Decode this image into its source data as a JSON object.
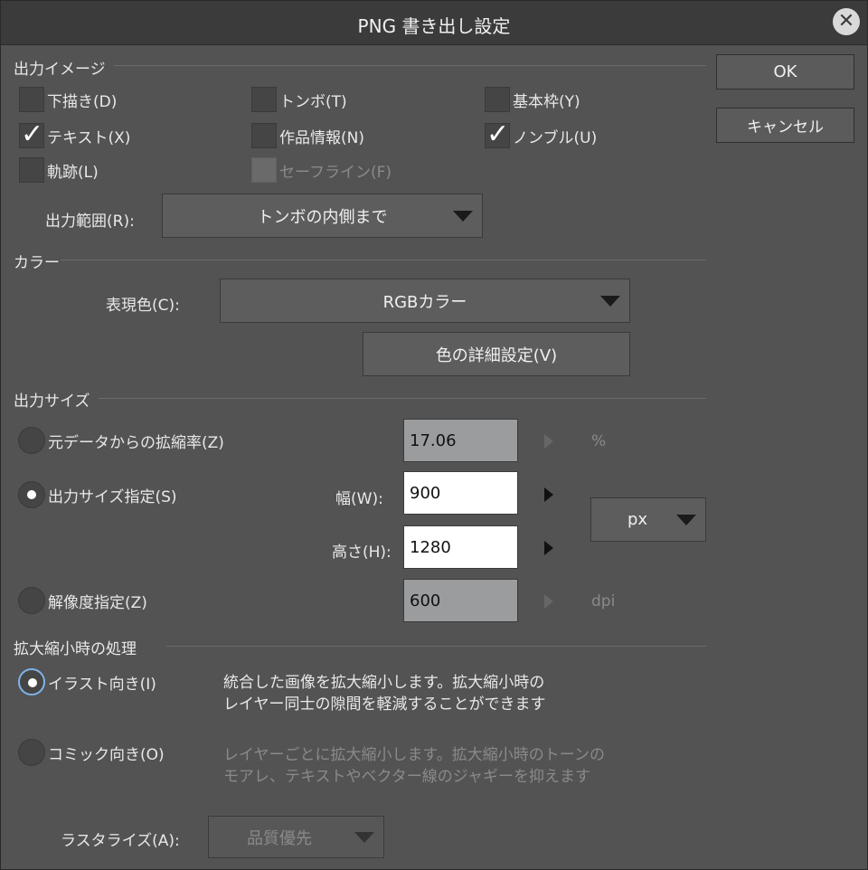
{
  "title": "PNG 書き出し設定",
  "buttons": {
    "ok": "OK",
    "cancel": "キャンセル"
  },
  "output_image": {
    "heading": "出力イメージ",
    "checkboxes": [
      {
        "label": "下描き(D)",
        "checked": false,
        "enabled": true
      },
      {
        "label": "トンボ(T)",
        "checked": false,
        "enabled": true
      },
      {
        "label": "基本枠(Y)",
        "checked": false,
        "enabled": true
      },
      {
        "label": "テキスト(X)",
        "checked": true,
        "enabled": true
      },
      {
        "label": "作品情報(N)",
        "checked": false,
        "enabled": true
      },
      {
        "label": "ノンブル(U)",
        "checked": true,
        "enabled": true
      },
      {
        "label": "軌跡(L)",
        "checked": false,
        "enabled": true
      },
      {
        "label": "セーフライン(F)",
        "checked": false,
        "enabled": false
      }
    ],
    "range_label": "出力範囲(R):",
    "range_value": "トンボの内側まで"
  },
  "color": {
    "heading": "カラー",
    "expression_label": "表現色(C):",
    "expression_value": "RGBカラー",
    "detail_button": "色の詳細設定(V)"
  },
  "output_size": {
    "heading": "出力サイズ",
    "scale_label": "元データからの拡縮率(Z)",
    "scale_value": "17.06",
    "scale_unit": "%",
    "size_label": "出力サイズ指定(S)",
    "width_label": "幅(W):",
    "width_value": "900",
    "height_label": "高さ(H):",
    "height_value": "1280",
    "unit_value": "px",
    "resolution_label": "解像度指定(Z)",
    "resolution_value": "600",
    "resolution_unit": "dpi",
    "selected": "size"
  },
  "scaling": {
    "heading": "拡大縮小時の処理",
    "illust_label": "イラスト向き(I)",
    "illust_desc_1": "統合した画像を拡大縮小します。拡大縮小時の",
    "illust_desc_2": "レイヤー同士の隙間を軽減することができます",
    "comic_label": "コミック向き(O)",
    "comic_desc_1": "レイヤーごとに拡大縮小します。拡大縮小時のトーンの",
    "comic_desc_2": "モアレ、テキストやベクター線のジャギーを抑えます",
    "rasterize_label": "ラスタライズ(A):",
    "rasterize_value": "品質優先",
    "selected": "illust"
  }
}
